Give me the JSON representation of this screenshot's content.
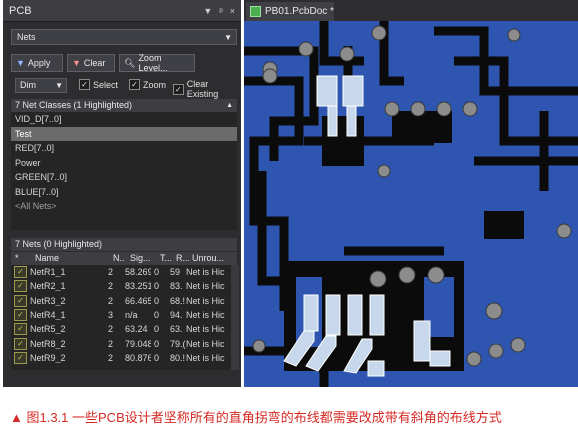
{
  "panel": {
    "title": "PCB",
    "icons": [
      "dropdown-arrow-icon",
      "pin-icon",
      "close-icon"
    ],
    "mode_select": "Nets",
    "buttons": {
      "apply": "Apply",
      "clear": "Clear",
      "zoom": "Zoom Level..."
    },
    "dim_select": "Dim",
    "checks": {
      "select": "Select",
      "zoom": "Zoom",
      "clear_existing": "Clear Existing"
    },
    "classes_header": "7 Net Classes (1 Highlighted)",
    "classes": [
      "VID_D[7..0]",
      "Test",
      "RED[7..0]",
      "Power",
      "GREEN[7..0]",
      "BLUE[7..0]",
      "<All Nets>"
    ],
    "nets_header": "7 Nets (0 Highlighted)",
    "columns": {
      "star": "*",
      "name": "Name",
      "n": "N..",
      "sig": "Sig...",
      "t": "T...",
      "r": "R...",
      "unrou": "Unrou..."
    },
    "nets": [
      {
        "name": "NetR1_1",
        "n": "2",
        "sig": "58.269",
        "t": "0",
        "r": "59",
        "unrou": "Net is Hic"
      },
      {
        "name": "NetR2_1",
        "n": "2",
        "sig": "83.251",
        "t": "0",
        "r": "83.",
        "unrou": "Net is Hic"
      },
      {
        "name": "NetR3_2",
        "n": "2",
        "sig": "66.465",
        "t": "0",
        "r": "68.!",
        "unrou": "Net is Hic"
      },
      {
        "name": "NetR4_1",
        "n": "3",
        "sig": "n/a",
        "t": "0",
        "r": "94.",
        "unrou": "Net is Hic"
      },
      {
        "name": "NetR5_2",
        "n": "2",
        "sig": "63.24",
        "t": "0",
        "r": "63.",
        "unrou": "Net is Hic"
      },
      {
        "name": "NetR8_2",
        "n": "2",
        "sig": "79.048",
        "t": "0",
        "r": "79.(",
        "unrou": "Net is Hic"
      },
      {
        "name": "NetR9_2",
        "n": "2",
        "sig": "80.876",
        "t": "0",
        "r": "80.!",
        "unrou": "Net is Hic"
      }
    ]
  },
  "document_tab": "PB01.PcbDoc *",
  "caption": "▲ 图1.3.1 一些PCB设计者坚称所有的直角拐弯的布线都需要改成带有斜角的布线方式",
  "colors": {
    "board_blue": "#2e56b0",
    "board_black": "#0b0b0b",
    "highlight_pad": "#c8d8ec",
    "caption_red": "#d42a24"
  }
}
